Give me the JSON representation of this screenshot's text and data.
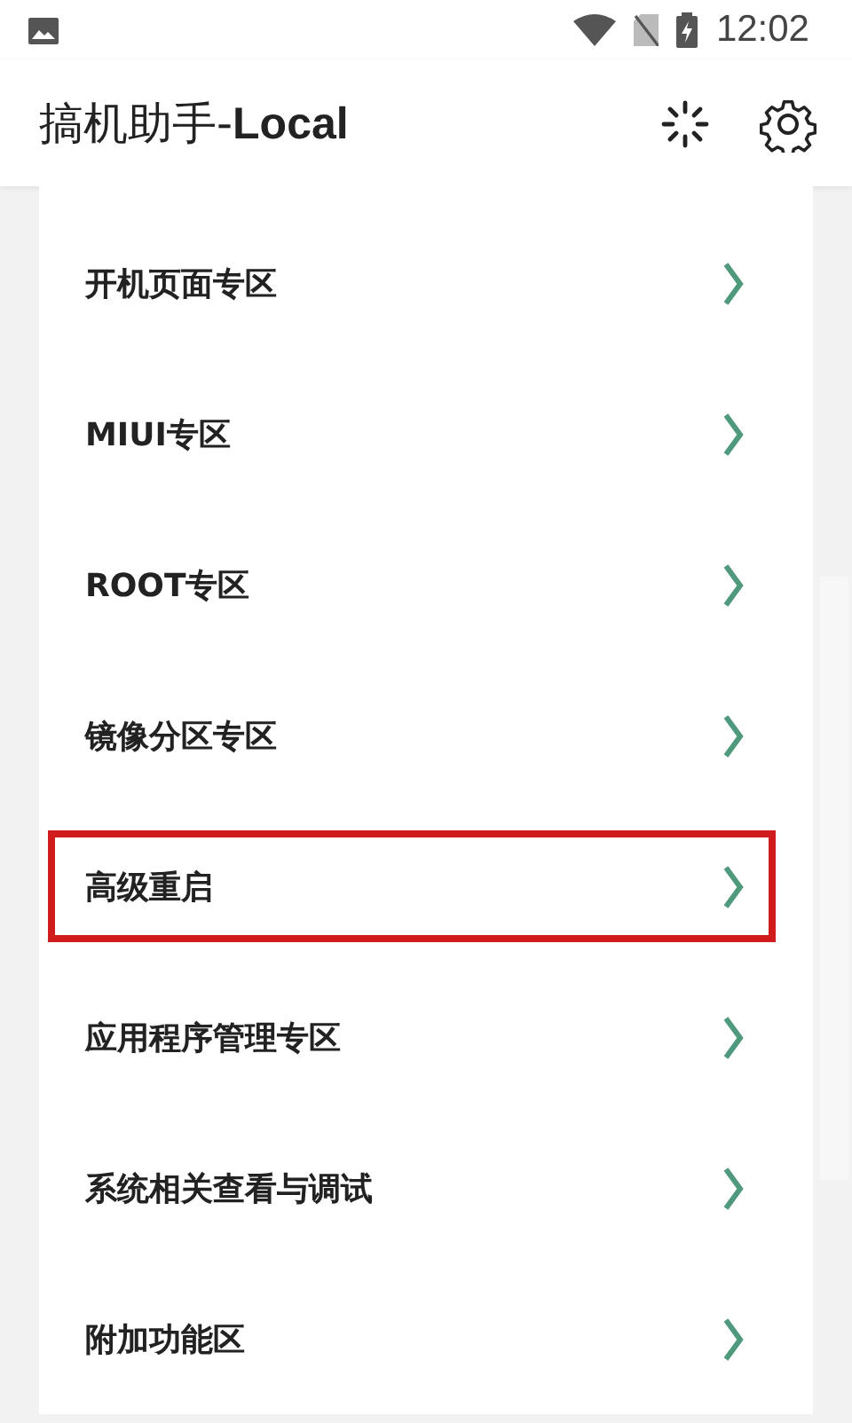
{
  "status_bar": {
    "time": "12:02"
  },
  "app_bar": {
    "title": "搞机助手-",
    "title_bold": "Local"
  },
  "menu_items": [
    {
      "label": "开机页面专区",
      "highlighted": false
    },
    {
      "label": "MIUI专区",
      "highlighted": false
    },
    {
      "label": "ROOT专区",
      "highlighted": false
    },
    {
      "label": "镜像分区专区",
      "highlighted": false
    },
    {
      "label": "高级重启",
      "highlighted": true
    },
    {
      "label": "应用程序管理专区",
      "highlighted": false
    },
    {
      "label": "系统相关查看与调试",
      "highlighted": false
    },
    {
      "label": "附加功能区",
      "highlighted": false
    }
  ]
}
